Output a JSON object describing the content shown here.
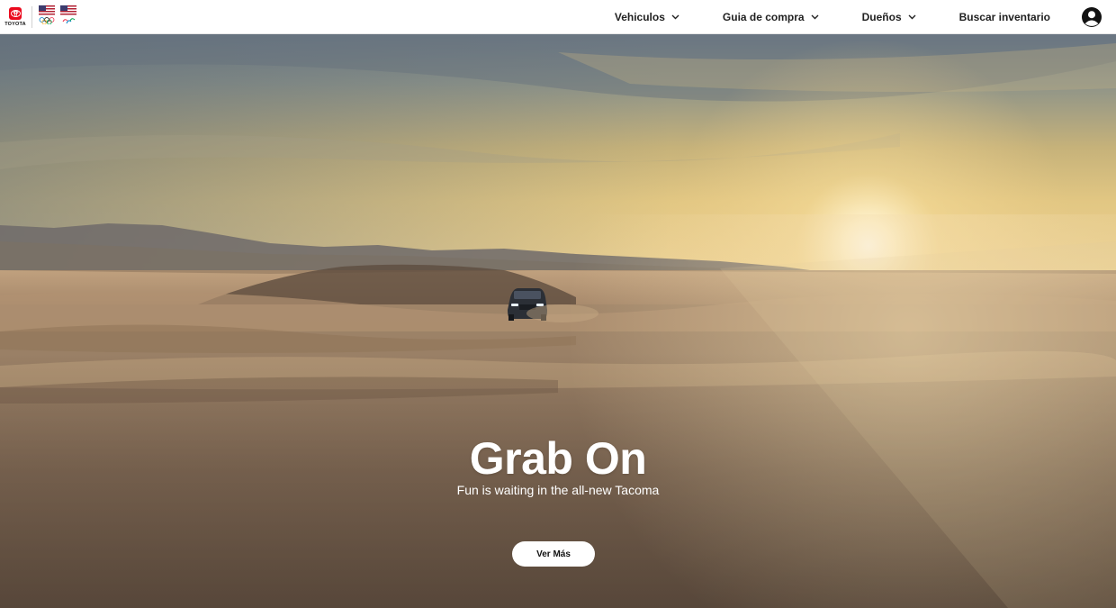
{
  "brand": {
    "logo_text": "TOYOTA",
    "brand_color": "#eb0a1e"
  },
  "nav": {
    "items": [
      {
        "label": "Vehiculos",
        "icon": "chevron-down-icon"
      },
      {
        "label": "Guia de compra",
        "icon": "chevron-down-icon"
      },
      {
        "label": "Dueños",
        "icon": "chevron-down-icon"
      },
      {
        "label": "Buscar inventario"
      }
    ],
    "account_icon": "account-circle-icon"
  },
  "hero": {
    "title": "Grab On",
    "subtitle": "Fun is waiting in the all-new Tacoma",
    "cta_label": "Ver Más",
    "image_subject": "desert-sunset-truck"
  }
}
